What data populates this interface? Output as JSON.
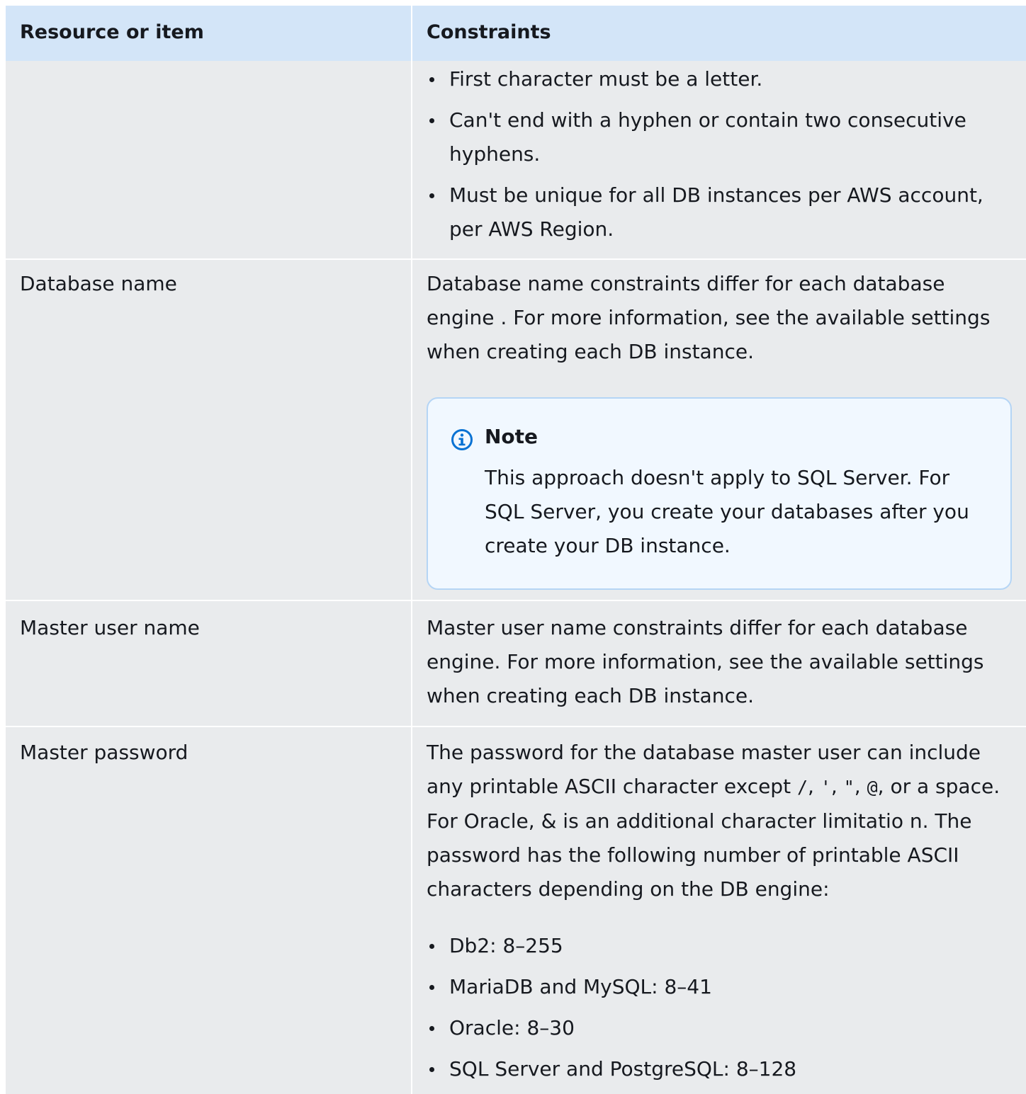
{
  "table": {
    "headers": {
      "col1": "Resource or item",
      "col2": "Constraints"
    },
    "row_cont": {
      "bullets": [
        "First character must be a letter.",
        "Can't end with a hyphen or contain two consecutive hyphens.",
        "Must be unique for all DB instances per AWS account, per AWS Region."
      ]
    },
    "row_dbname": {
      "item": "Database name",
      "text": "Database name constraints differ for each database engine . For more information, see the available settings when creating each DB instance.",
      "note": {
        "title": "Note",
        "body": "This approach doesn't apply to SQL Server. For SQL Server, you create your databases after you create your DB instance."
      }
    },
    "row_master_user": {
      "item": "Master user name",
      "text": "Master user name constraints differ for each database engine. For more information, see the available settings when creating each DB instance."
    },
    "row_master_password": {
      "item": "Master password",
      "text_a": "The password for the database master user can include any printable ASCII character except ",
      "code_slash": "/",
      "sep1": ", ",
      "code_quote": "'",
      "sep2": ", ",
      "code_dquote": "\"",
      "sep3": ", ",
      "code_at": "@",
      "text_b": ", or a space. For Oracle, ",
      "code_amp": "&",
      "text_c": " is an additional character limitatio n. The password has the following number of printable ASCII characters depending on the DB engine:",
      "bullets": [
        "Db2: 8–255",
        "MariaDB and MySQL: 8–41",
        "Oracle: 8–30",
        "SQL Server and PostgreSQL: 8–128"
      ]
    }
  },
  "colors": {
    "header_bg": "#d3e5f8",
    "row_bg": "#e9ebed",
    "note_bg": "#f1f8ff",
    "note_border": "#b5d5f5",
    "info_icon": "#0972d3"
  },
  "icons": {
    "note": "info-icon"
  }
}
